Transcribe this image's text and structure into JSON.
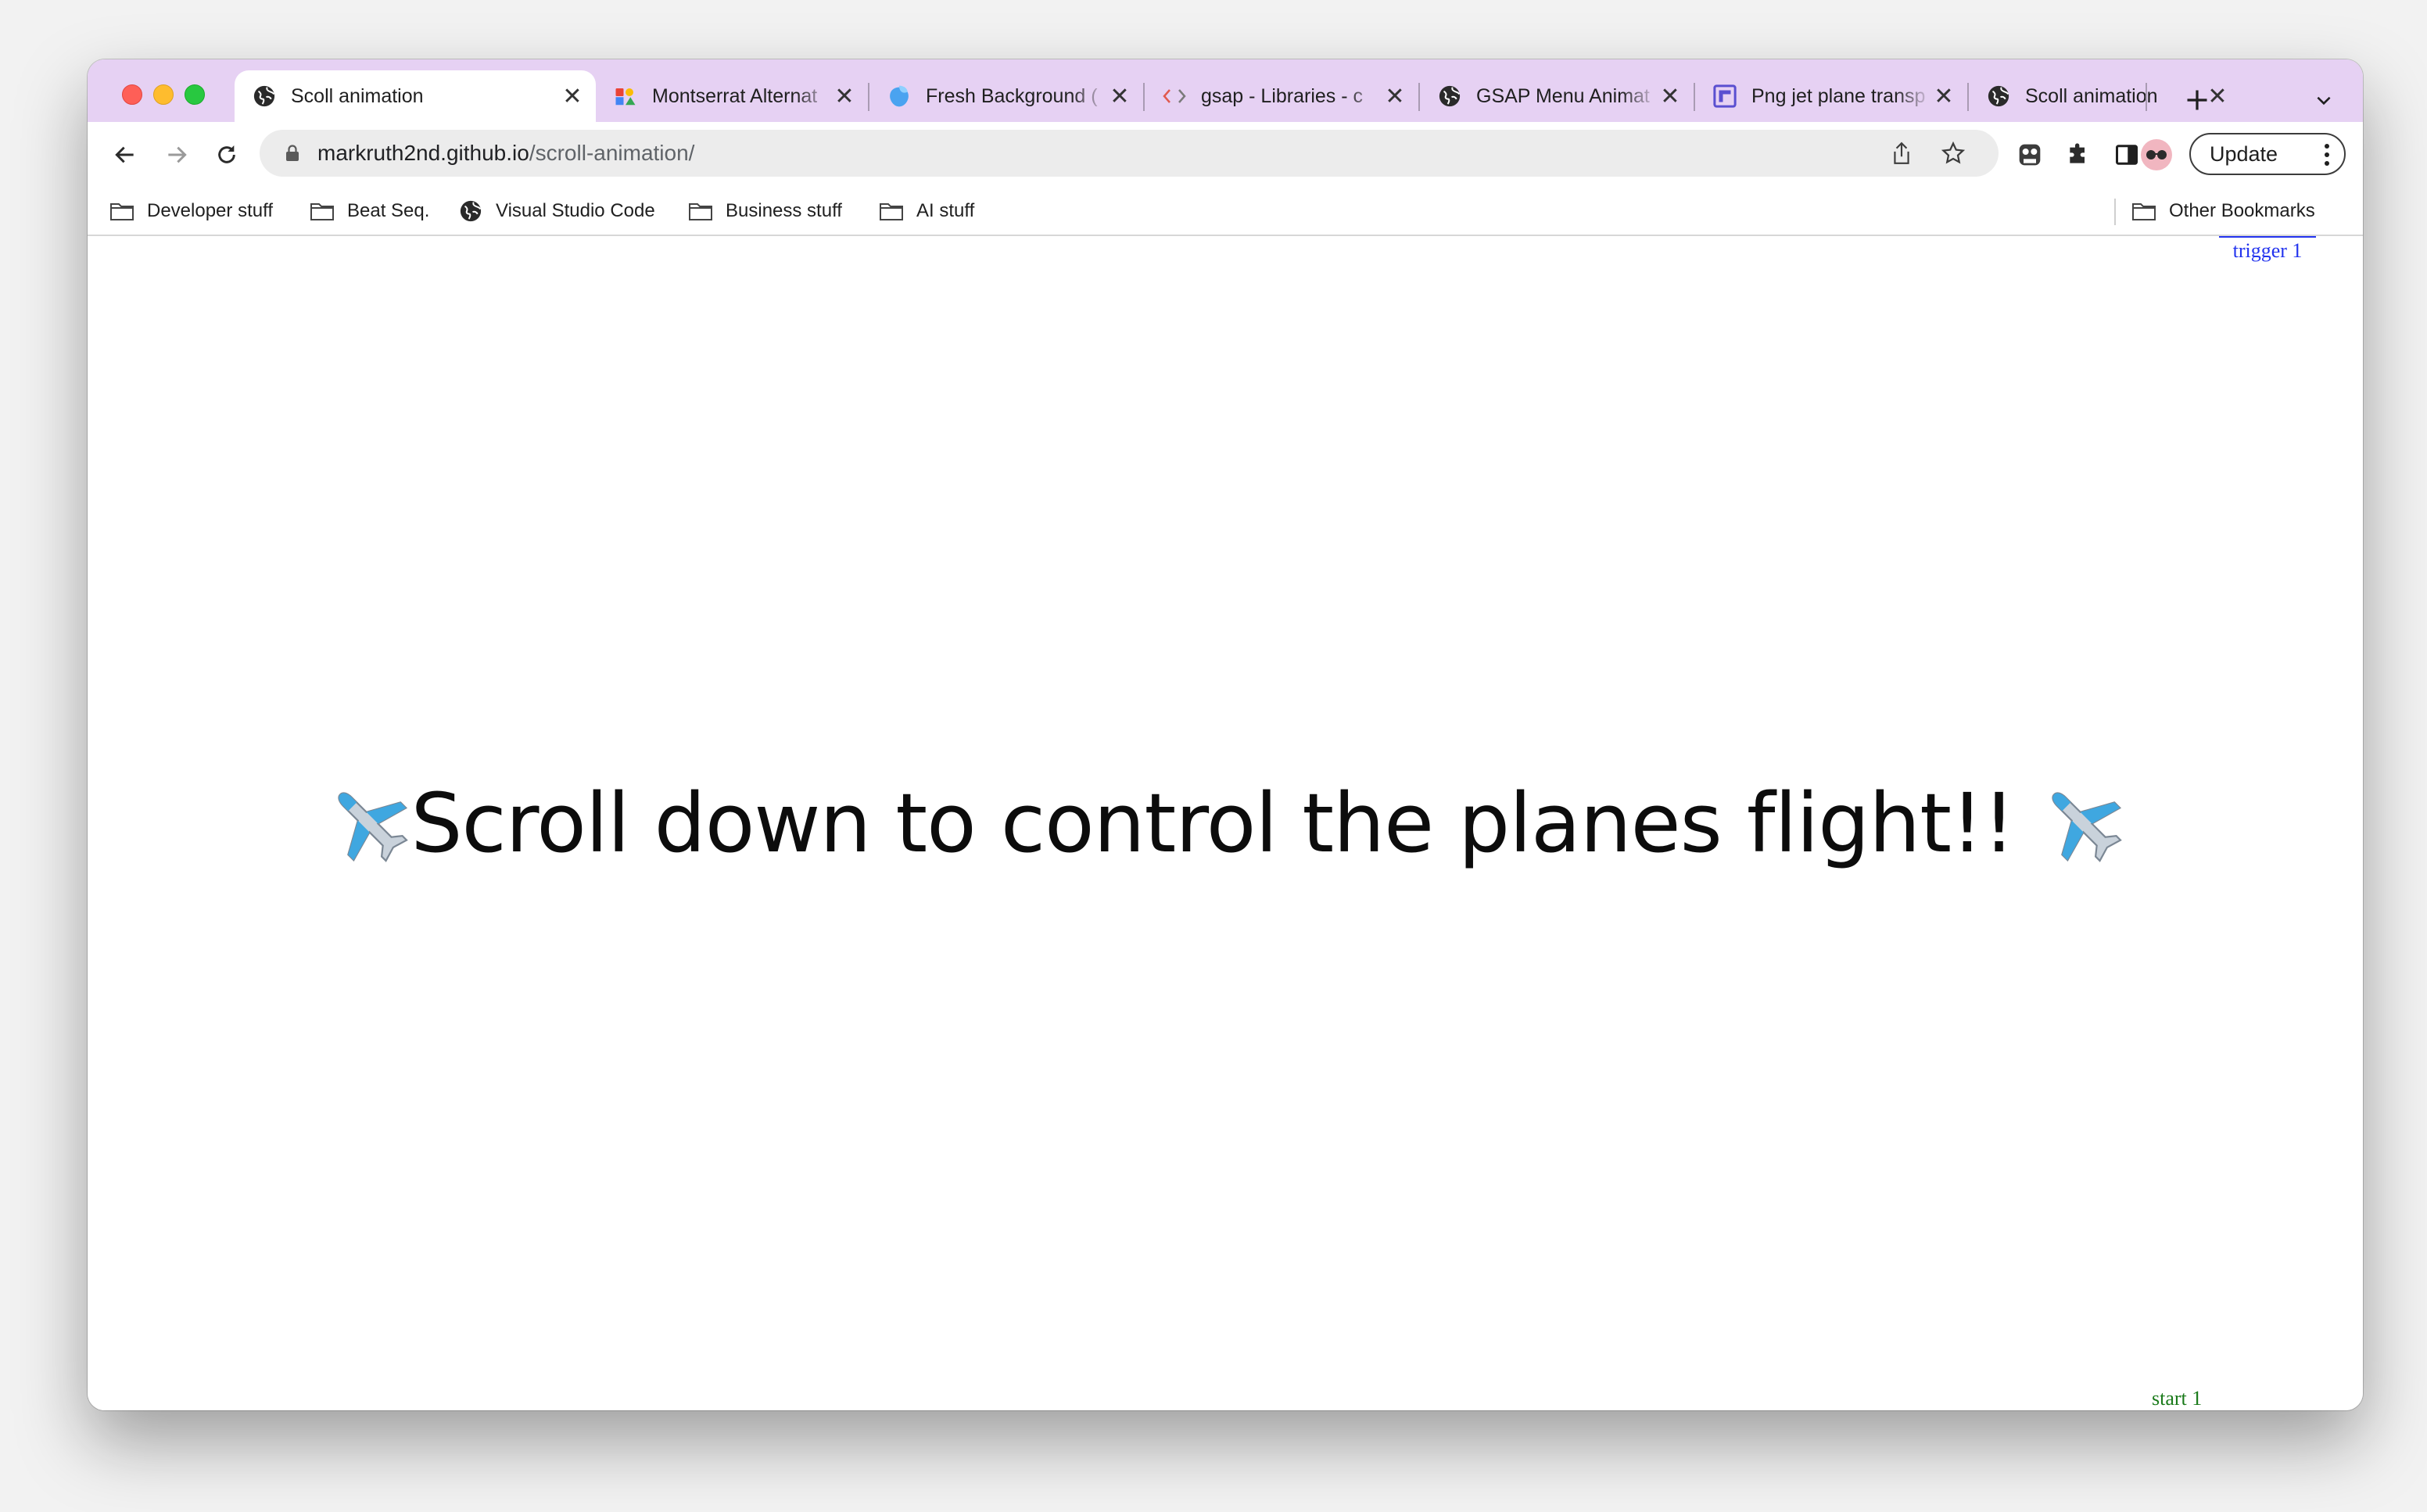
{
  "browser": {
    "tabs": [
      {
        "title": "Scoll animation",
        "icon": "globe-icon",
        "active": true
      },
      {
        "title": "Montserrat Alternat",
        "icon": "google-fonts-icon",
        "active": false
      },
      {
        "title": "Fresh Background (",
        "icon": "blob-icon",
        "active": false
      },
      {
        "title": "gsap - Libraries - c",
        "icon": "code-icon",
        "active": false
      },
      {
        "title": "GSAP Menu Animat",
        "icon": "globe-icon",
        "active": false
      },
      {
        "title": "Png jet plane transp",
        "icon": "site-icon",
        "active": false
      },
      {
        "title": "Scoll animation",
        "icon": "globe-icon",
        "active": false
      }
    ],
    "address": {
      "host": "markruth2nd.github.io",
      "path": "/scroll-animation/"
    },
    "update_label": "Update",
    "bookmarks": [
      {
        "label": "Developer stuff",
        "icon": "folder-icon"
      },
      {
        "label": "Beat Seq.",
        "icon": "folder-icon"
      },
      {
        "label": "Visual Studio Code",
        "icon": "globe-icon"
      },
      {
        "label": "Business stuff",
        "icon": "folder-icon"
      },
      {
        "label": "AI stuff",
        "icon": "folder-icon"
      }
    ],
    "other_bookmarks": "Other Bookmarks",
    "colors": {
      "tab_strip": "#e6d1f3",
      "marker_trigger": "#2233ee",
      "marker_start": "#1a7a1a"
    }
  },
  "page": {
    "headline": "Scroll down to control the planes flight!!",
    "trigger_marker": "trigger 1",
    "start_marker": "start 1"
  }
}
